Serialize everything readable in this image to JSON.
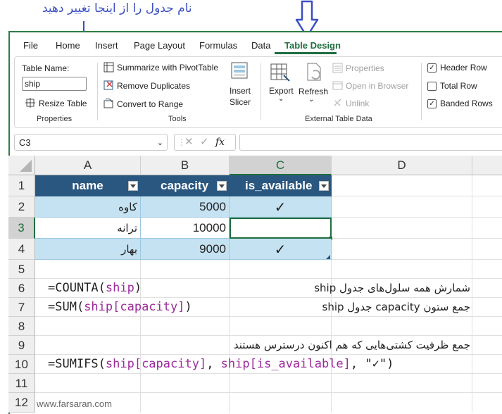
{
  "annotation": {
    "text": "نام جدول را از اینجا تغییر دهید"
  },
  "menu": {
    "items": [
      "File",
      "Home",
      "Insert",
      "Page Layout",
      "Formulas",
      "Data",
      "Table Design"
    ],
    "active": "Table Design"
  },
  "ribbon": {
    "properties": {
      "table_name_label": "Table Name:",
      "table_name_value": "ship",
      "resize": "Resize Table",
      "group": "Properties"
    },
    "tools": {
      "summarize": "Summarize with PivotTable",
      "remove_duplicates": "Remove Duplicates",
      "convert": "Convert to Range",
      "insert_slicer_1": "Insert",
      "insert_slicer_2": "Slicer",
      "group": "Tools"
    },
    "external": {
      "export": "Export",
      "refresh": "Refresh",
      "properties": "Properties",
      "open_browser": "Open in Browser",
      "unlink": "Unlink",
      "group": "External Table Data"
    },
    "style_options": {
      "header_row": "Header Row",
      "total_row": "Total Row",
      "banded_rows": "Banded Rows",
      "header_row_checked": true,
      "total_row_checked": false,
      "banded_rows_checked": true
    }
  },
  "formula_bar": {
    "name_box": "C3",
    "fx": "fx",
    "formula": ""
  },
  "columns": [
    "A",
    "B",
    "C",
    "D"
  ],
  "rows": [
    "1",
    "2",
    "3",
    "4",
    "5",
    "6",
    "7",
    "8",
    "9",
    "10",
    "11",
    "12"
  ],
  "table": {
    "headers": [
      "name",
      "capacity",
      "is_available"
    ],
    "rows": [
      {
        "name": "کاوه",
        "capacity": "5000",
        "is_available": "✓"
      },
      {
        "name": "ترانه",
        "capacity": "10000",
        "is_available": ""
      },
      {
        "name": "بهار",
        "capacity": "9000",
        "is_available": "✓"
      }
    ]
  },
  "sheet": {
    "r6": {
      "formula_prefix": "=COUNTA(",
      "formula_ref": "ship",
      "formula_suffix": ")",
      "note": "شمارش همه سلول‌های جدول ship"
    },
    "r7": {
      "formula_prefix": "=SUM(",
      "formula_ref": "ship[capacity]",
      "formula_suffix": ")",
      "note": "جمع ستون capacity جدول ship"
    },
    "r9": {
      "note": "جمع ظرفیت کشتی‌هایی که هم اکنون درسترس هستند"
    },
    "r10": {
      "formula_prefix": "=SUMIFS(",
      "ref1": "ship[capacity]",
      "sep": ", ",
      "ref2": "ship[is_available]",
      "suffix": ", \"✓\")"
    }
  },
  "watermark": "www.farsaran.com",
  "colors": {
    "table_header": "#2a5780",
    "band": "#c5e2f2",
    "accent": "#1e6e3f",
    "annotation": "#3a4fc4",
    "ref": "#9c2a9c"
  }
}
